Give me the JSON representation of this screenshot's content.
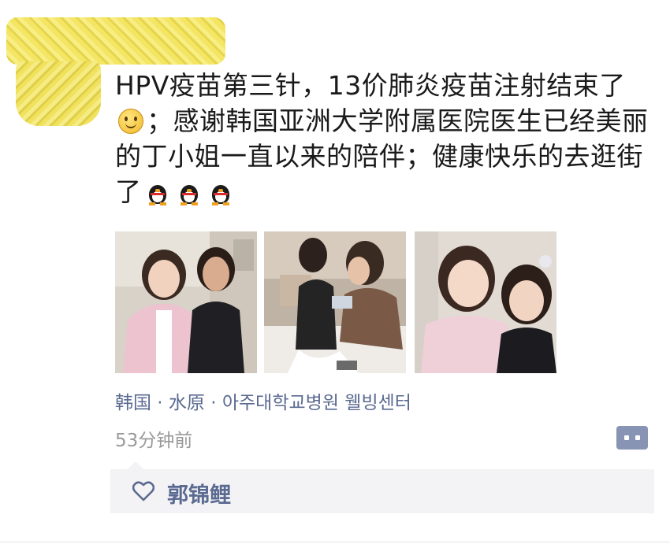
{
  "post": {
    "text_part1": "HPV疫苗第三针，13价肺炎疫苗注射结束了",
    "text_part2": "；感谢韩国亚洲大学附属医院医生已经美丽的丁小姐一直以来的陪伴；健康快乐的去逛街了",
    "emojis": [
      "smile-emoji",
      "penguin-emoji",
      "penguin-emoji",
      "penguin-emoji"
    ]
  },
  "photos": [
    {
      "name": "photo-two-women-lobby"
    },
    {
      "name": "photo-vaccination"
    },
    {
      "name": "photo-two-women-selfie"
    }
  ],
  "meta": {
    "location": "韩国 · 水原 · 아주대학교병원 웰빙센터",
    "time": "53分钟前"
  },
  "likes": {
    "names": "郭锦鲤"
  },
  "colors": {
    "link": "#5b6a91",
    "meta_gray": "#999999",
    "likes_bg": "#f3f3f5",
    "comment_button": "#8794b4"
  }
}
